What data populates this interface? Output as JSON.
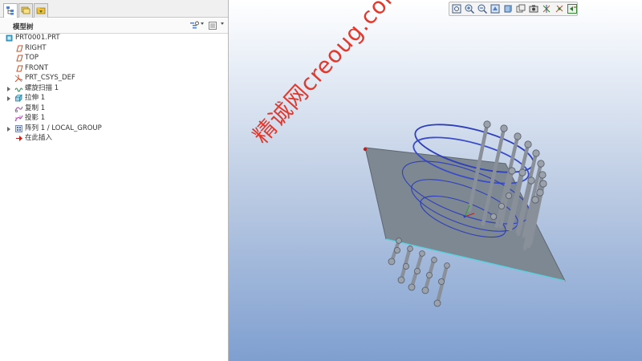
{
  "left_panel": {
    "title": "模型树",
    "tabs": [
      "model-tree",
      "layers",
      "folder-browser"
    ],
    "items": [
      {
        "label": "PRT0001.PRT",
        "icon": "part-icon",
        "indent": 0,
        "expand": false
      },
      {
        "label": "RIGHT",
        "icon": "datum-plane-icon",
        "indent": 1,
        "expand": false
      },
      {
        "label": "TOP",
        "icon": "datum-plane-icon",
        "indent": 1,
        "expand": false
      },
      {
        "label": "FRONT",
        "icon": "datum-plane-icon",
        "indent": 1,
        "expand": false
      },
      {
        "label": "PRT_CSYS_DEF",
        "icon": "csys-icon",
        "indent": 1,
        "expand": false
      },
      {
        "label": "螺旋扫描 1",
        "icon": "helical-sweep-icon",
        "indent": 1,
        "expand": true
      },
      {
        "label": "拉伸 1",
        "icon": "extrude-icon",
        "indent": 1,
        "expand": true
      },
      {
        "label": "复制 1",
        "icon": "copy-icon",
        "indent": 1,
        "expand": false
      },
      {
        "label": "投影 1",
        "icon": "projection-icon",
        "indent": 1,
        "expand": false
      },
      {
        "label": "阵列 1 / LOCAL_GROUP",
        "icon": "pattern-icon",
        "indent": 1,
        "expand": true
      },
      {
        "label": "在此插入",
        "icon": "insert-here-icon",
        "indent": 1,
        "expand": false
      }
    ]
  },
  "viewport": {
    "toolbar_buttons": [
      "refit-icon",
      "zoom-in-icon",
      "zoom-out-icon",
      "repaint-icon",
      "display-style-icon",
      "saved-views-icon",
      "view-manager-icon",
      "datum-display-icon",
      "spin-center-icon",
      "annotation-display-icon"
    ],
    "watermark": "精诚网creoug.com",
    "colors": {
      "plate": "#7d8893",
      "helix": "#2f3fb8",
      "rod": "#8a9099",
      "bg_top": "#ffffff",
      "bg_bottom": "#7f9fd0"
    }
  }
}
